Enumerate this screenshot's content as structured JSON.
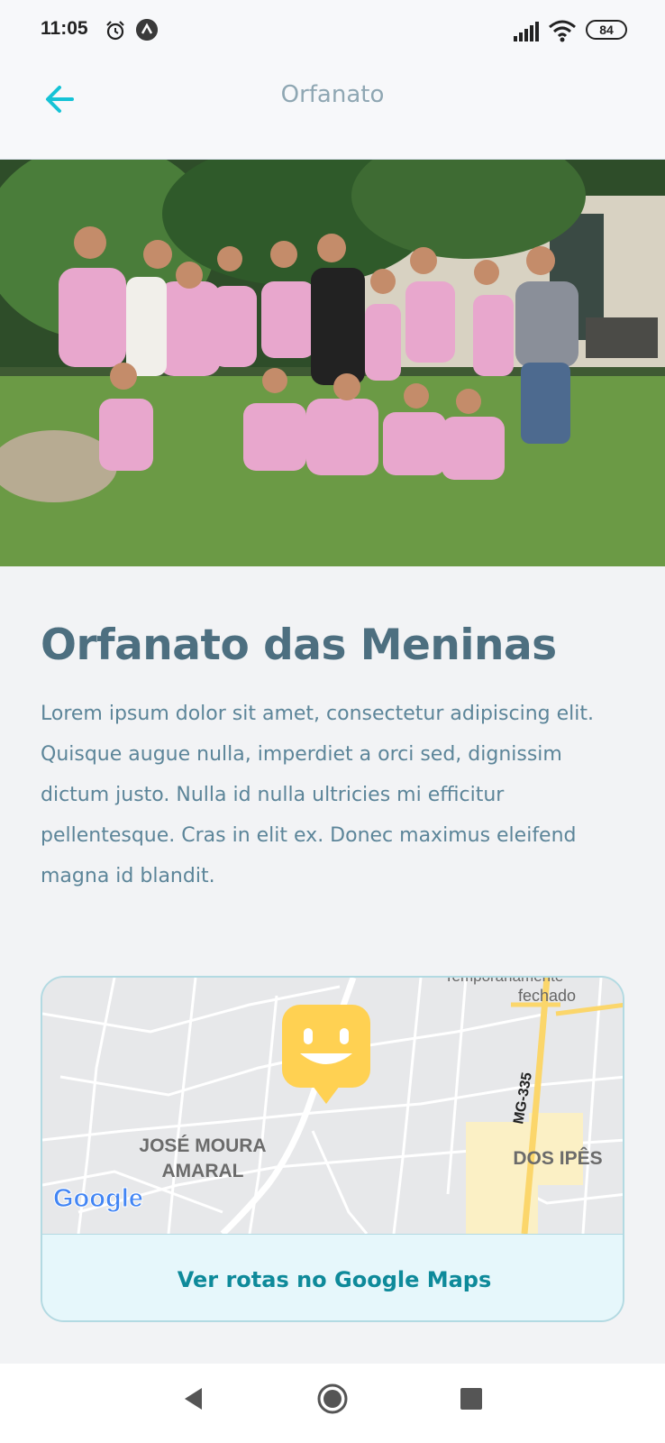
{
  "status_bar": {
    "time": "11:05",
    "battery": "84",
    "icons": [
      "alarm-icon",
      "app-status-icon",
      "signal-icon",
      "wifi-icon",
      "battery-icon"
    ]
  },
  "header": {
    "title": "Orfanato",
    "back_icon": "arrow-left-icon",
    "accent_color": "#15c3d6"
  },
  "hero_image": {
    "description_icon": "group-photo"
  },
  "orphanage": {
    "name": "Orfanato das Meninas",
    "description": "Lorem ipsum dolor sit amet, consectetur adipiscing elit. Quisque augue nulla, imperdiet a orci sed, dignissim dictum justo. Nulla id nulla ultricies mi efficitur pellentesque. Cras in elit ex. Donec maximus eleifend magna id blandit."
  },
  "map": {
    "labels": {
      "temp_closed_1": "Temporariamente",
      "temp_closed_2": "fechado",
      "road": "MG-335",
      "district_1a": "JOSÉ MOURA",
      "district_1b": "AMARAL",
      "district_2": "DOS IPÊS",
      "google": "Google"
    },
    "marker_icon": "happy-marker-icon",
    "marker_color": "#ffd152",
    "route_link": "Ver rotas no Google Maps"
  },
  "nav_bar": {
    "icons": [
      "nav-back-icon",
      "nav-home-icon",
      "nav-recents-icon"
    ]
  }
}
